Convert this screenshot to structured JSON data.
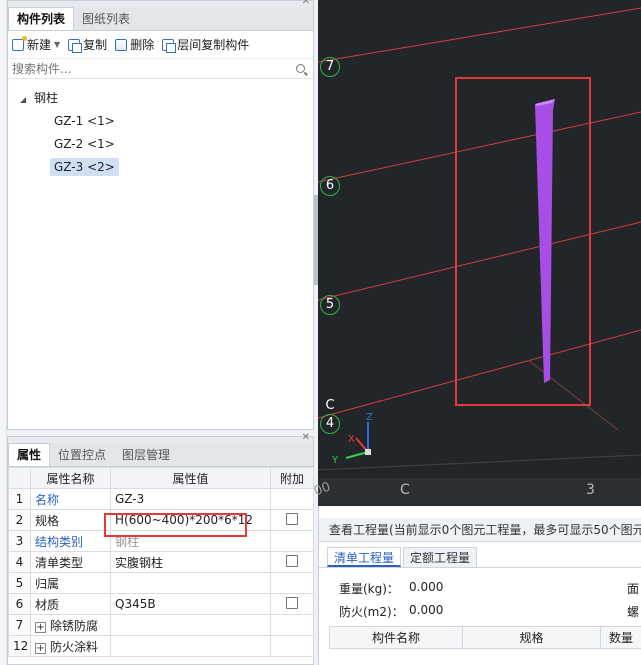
{
  "component_panel": {
    "tabs": [
      "构件列表",
      "图纸列表"
    ],
    "toolbar": {
      "new_label": "新建",
      "copy_label": "复制",
      "delete_label": "删除",
      "layer_copy_label": "层间复制构件"
    },
    "search_placeholder": "搜索构件...",
    "tree": {
      "root_label": "钢柱",
      "children": [
        "GZ-1 <1>",
        "GZ-2 <1>",
        "GZ-3 <2>"
      ],
      "selected_index": 2
    }
  },
  "property_panel": {
    "tabs": [
      "属性",
      "位置控点",
      "图层管理"
    ],
    "headers": {
      "name": "属性名称",
      "value": "属性值",
      "extra": "附加"
    },
    "rows": [
      {
        "num": "1",
        "name": "名称",
        "value": "GZ-3",
        "blue": true,
        "checkbox": false
      },
      {
        "num": "2",
        "name": "规格",
        "value": "H(600~400)*200*6*12",
        "blue": false,
        "checkbox": true
      },
      {
        "num": "3",
        "name": "结构类别",
        "value": "钢柱",
        "blue": true,
        "checkbox": false
      },
      {
        "num": "4",
        "name": "清单类型",
        "value": "实腹钢柱",
        "blue": false,
        "checkbox": true
      },
      {
        "num": "5",
        "name": "归属",
        "value": "",
        "blue": false,
        "checkbox": false
      },
      {
        "num": "6",
        "name": "材质",
        "value": "Q345B",
        "blue": false,
        "checkbox": true
      },
      {
        "num": "7",
        "name": "除锈防腐",
        "value": "",
        "blue": false,
        "checkbox": false,
        "expand": true
      },
      {
        "num": "12",
        "name": "防火涂料",
        "value": "",
        "blue": false,
        "checkbox": false,
        "expand": true
      }
    ]
  },
  "viewport": {
    "axis_labels": [
      "7",
      "6",
      "5",
      "4",
      "C",
      "C",
      "3"
    ],
    "bottom_partial": "00",
    "axis_x": "X",
    "axis_y": "Y",
    "axis_z": "Z",
    "colors": {
      "background": "#232629",
      "grid_line": "#d23c46",
      "member": "#a64ee6",
      "highlight": "#e23a3a",
      "badge": "#2fb24a"
    }
  },
  "quantity_panel": {
    "title": "查看工程量(当前显示0个图元工程量，最多可显示50个图元",
    "tabs": [
      "清单工程量",
      "定额工程量"
    ],
    "weight_label": "重量(kg)：",
    "weight_value": "0.000",
    "fire_label": "防火(m2)：",
    "fire_value": "0.000",
    "right_partial_1": "面",
    "right_partial_2": "螺",
    "table_headers": [
      "构件名称",
      "规格",
      "数量"
    ]
  }
}
